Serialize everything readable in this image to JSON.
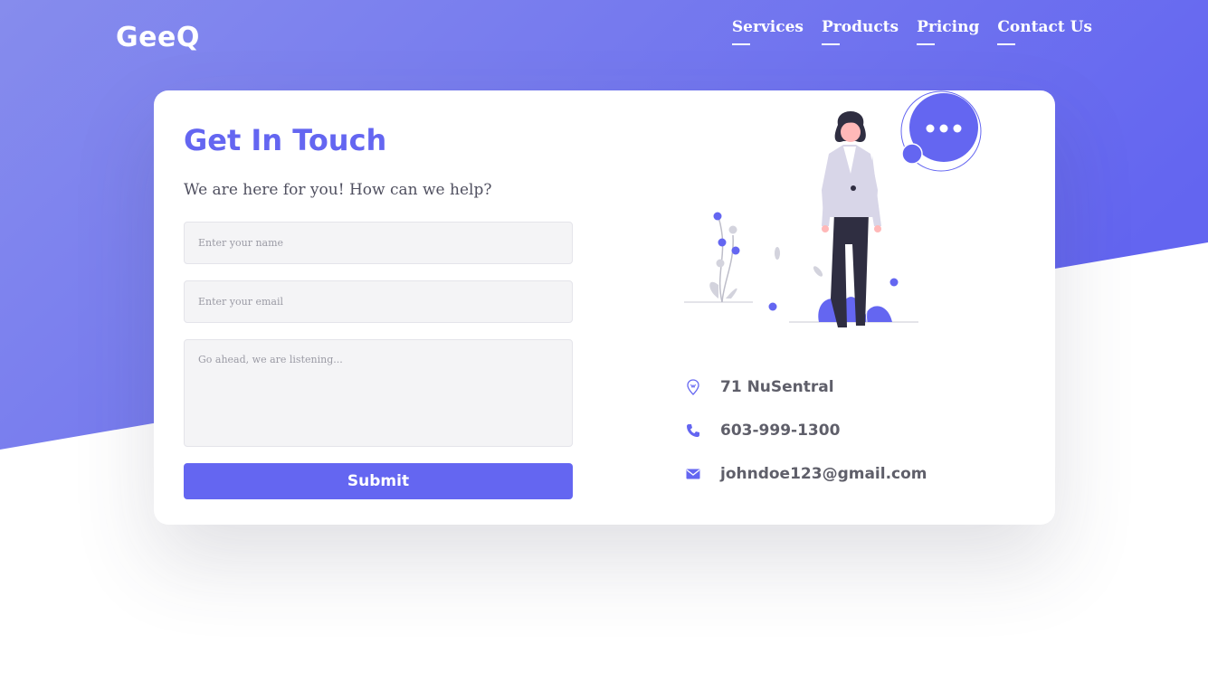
{
  "brand": {
    "name": "GeeQ"
  },
  "nav": {
    "items": [
      {
        "label": "Services"
      },
      {
        "label": "Products"
      },
      {
        "label": "Pricing"
      },
      {
        "label": "Contact Us"
      }
    ]
  },
  "form": {
    "title": "Get In Touch",
    "subtitle": "We are here for you! How can we help?",
    "name_placeholder": "Enter your name",
    "email_placeholder": "Enter your email",
    "message_placeholder": "Go ahead, we are listening...",
    "submit_label": "Submit"
  },
  "contact": {
    "address": "71 NuSentral",
    "phone": "603-999-1300",
    "email": "johndoe123@gmail.com"
  },
  "colors": {
    "accent": "#6466f1",
    "gradient_start": "#8187ee",
    "gradient_end": "#6466f1"
  },
  "icons": {
    "address": "location-pin-icon",
    "phone": "phone-icon",
    "email": "envelope-icon"
  }
}
